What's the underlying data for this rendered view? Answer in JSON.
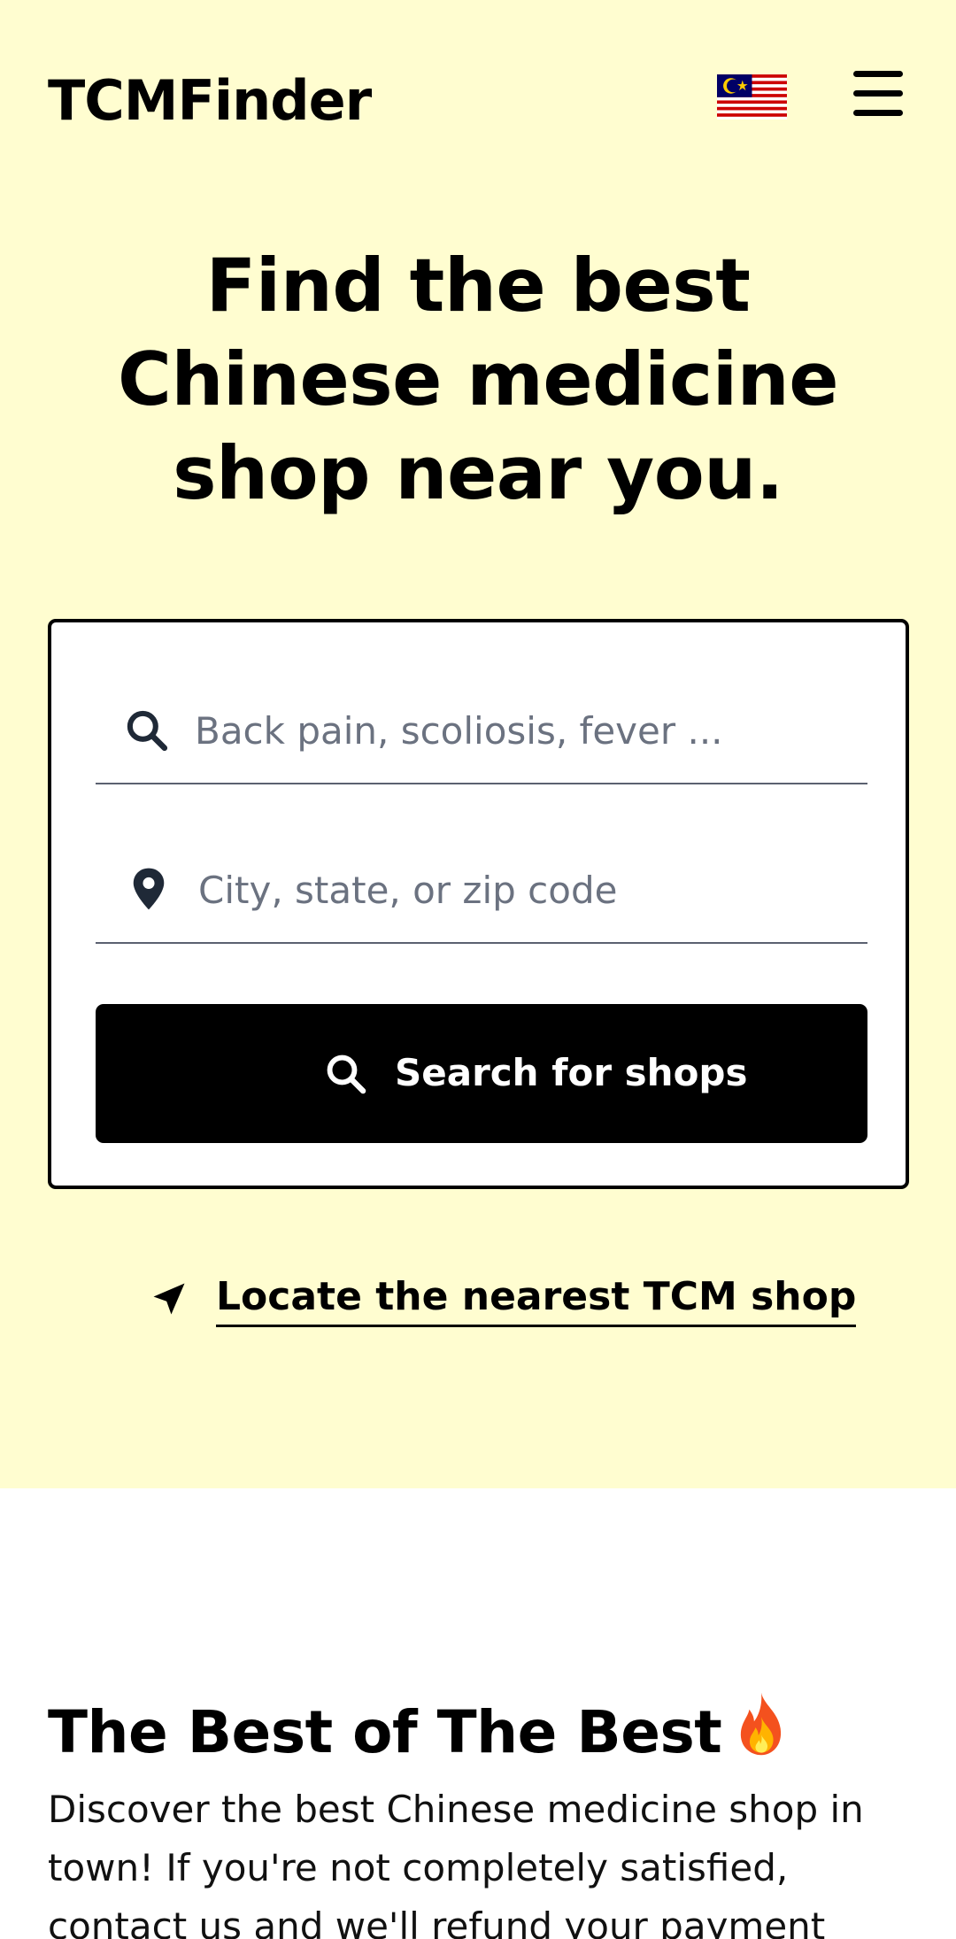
{
  "header": {
    "logo": "TCMFinder",
    "flag_icon": "malaysia-flag-icon",
    "menu_icon": "hamburger-menu-icon"
  },
  "hero": {
    "headline": "Find the best Chinese medicine shop near you.",
    "background_color": "#fffdd0"
  },
  "search": {
    "what_placeholder": "Back pain, scoliosis, fever ...",
    "what_value": "",
    "what_icon": "search-icon",
    "where_placeholder": "City, state, or zip code",
    "where_value": "",
    "where_icon": "map-pin-icon",
    "button_label": "Search for shops",
    "button_icon": "search-icon"
  },
  "locate": {
    "label": "Locate the nearest TCM shop",
    "icon": "location-arrow-icon"
  },
  "best_section": {
    "title": "The Best of The Best",
    "title_icon": "fire-icon",
    "description": "Discover the best Chinese medicine shop in town! If you're not completely satisfied, contact us and we'll refund your payment"
  }
}
